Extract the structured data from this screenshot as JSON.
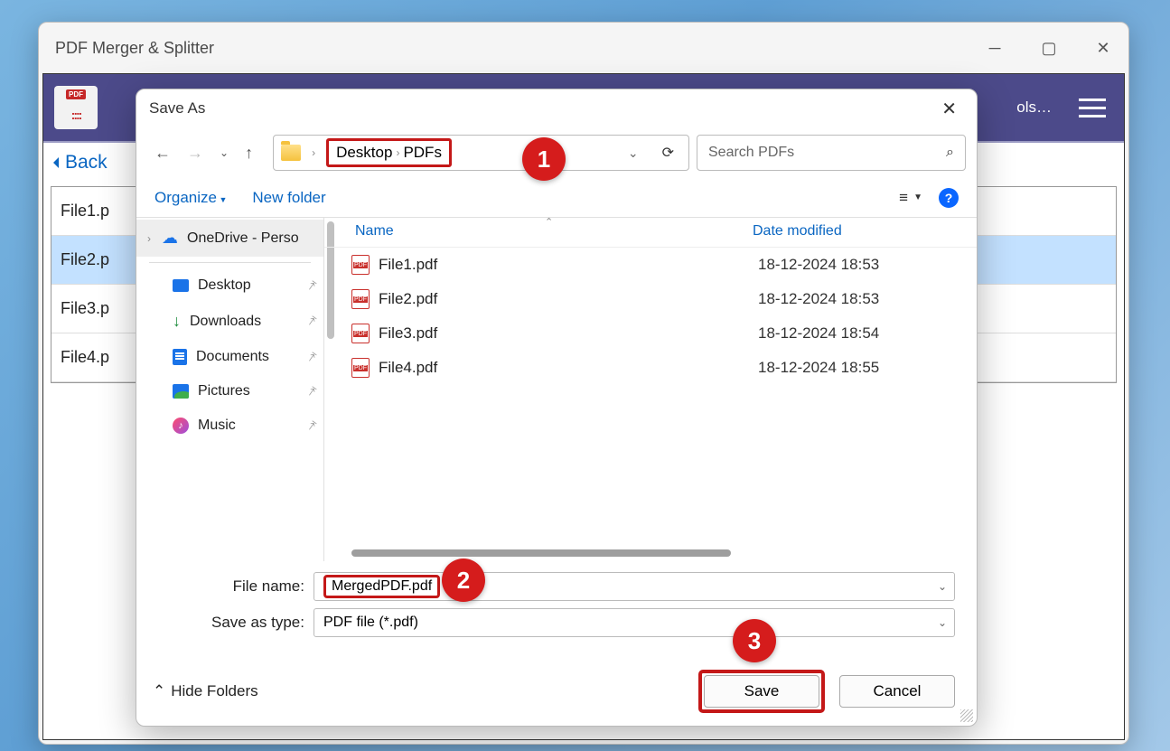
{
  "outer": {
    "title": "PDF Merger & Splitter",
    "tools": "ols…",
    "back": "Back",
    "files": [
      "File1.p",
      "File2.p",
      "File3.p",
      "File4.p"
    ],
    "selected_index": 1
  },
  "saveas": {
    "title": "Save As",
    "breadcrumb": {
      "part1": "Desktop",
      "part2": "PDFs"
    },
    "search_placeholder": "Search PDFs",
    "organize": "Organize",
    "new_folder": "New folder",
    "sidebar": {
      "onedrive": "OneDrive - Perso",
      "desktop": "Desktop",
      "downloads": "Downloads",
      "documents": "Documents",
      "pictures": "Pictures",
      "music": "Music"
    },
    "columns": {
      "name": "Name",
      "date": "Date modified"
    },
    "files": [
      {
        "name": "File1.pdf",
        "date": "18-12-2024 18:53"
      },
      {
        "name": "File2.pdf",
        "date": "18-12-2024 18:53"
      },
      {
        "name": "File3.pdf",
        "date": "18-12-2024 18:54"
      },
      {
        "name": "File4.pdf",
        "date": "18-12-2024 18:55"
      }
    ],
    "filename_label": "File name:",
    "filename_value": "MergedPDF.pdf",
    "saveastype_label": "Save as type:",
    "saveastype_value": "PDF file (*.pdf)",
    "hide_folders": "Hide Folders",
    "save": "Save",
    "cancel": "Cancel"
  },
  "annotations": {
    "a1": "1",
    "a2": "2",
    "a3": "3"
  }
}
